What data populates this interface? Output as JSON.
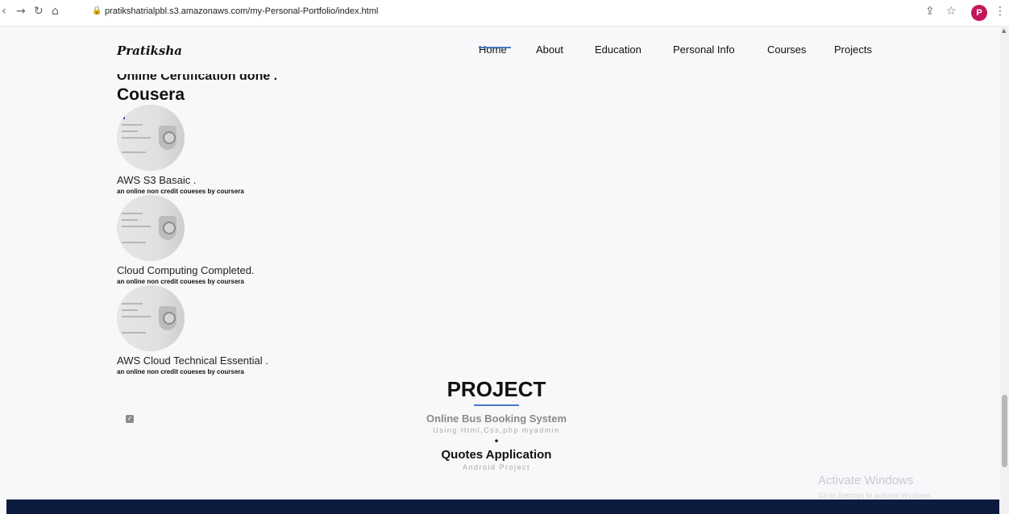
{
  "browser": {
    "url": "pratikshatrialpbl.s3.amazonaws.com/my-Personal-Portfolio/index.html",
    "avatar_letter": "P",
    "avatar_color": "#c2185b"
  },
  "site": {
    "logo": "Pratiksha",
    "nav": [
      "Home",
      "About",
      "Education",
      "Personal Info",
      "Courses",
      "Projects"
    ],
    "active_nav": "Home",
    "accent_color": "#4a78c4"
  },
  "certifications": {
    "heading": "Online Certification done .",
    "provider": "Cousera",
    "items": [
      {
        "title": "AWS S3 Basaic .",
        "subtitle": "an online non credit coueses by coursera"
      },
      {
        "title": "Cloud Computing Completed.",
        "subtitle": "an online non credit coueses by coursera"
      },
      {
        "title": "AWS Cloud Technical Essential .",
        "subtitle": "an online non credit coueses by coursera"
      }
    ]
  },
  "project": {
    "heading": "PROJECT",
    "items": [
      {
        "title": "Online Bus Booking System",
        "subtitle": "Using Html,Css,php myadmin"
      },
      {
        "title": "Quotes Application",
        "subtitle": "Android Project"
      }
    ],
    "bullet": "•"
  },
  "watermark": {
    "title": "Activate Windows",
    "subtitle": "Go to Settings to activate Windows."
  },
  "footer_color": "#0d1b3e"
}
